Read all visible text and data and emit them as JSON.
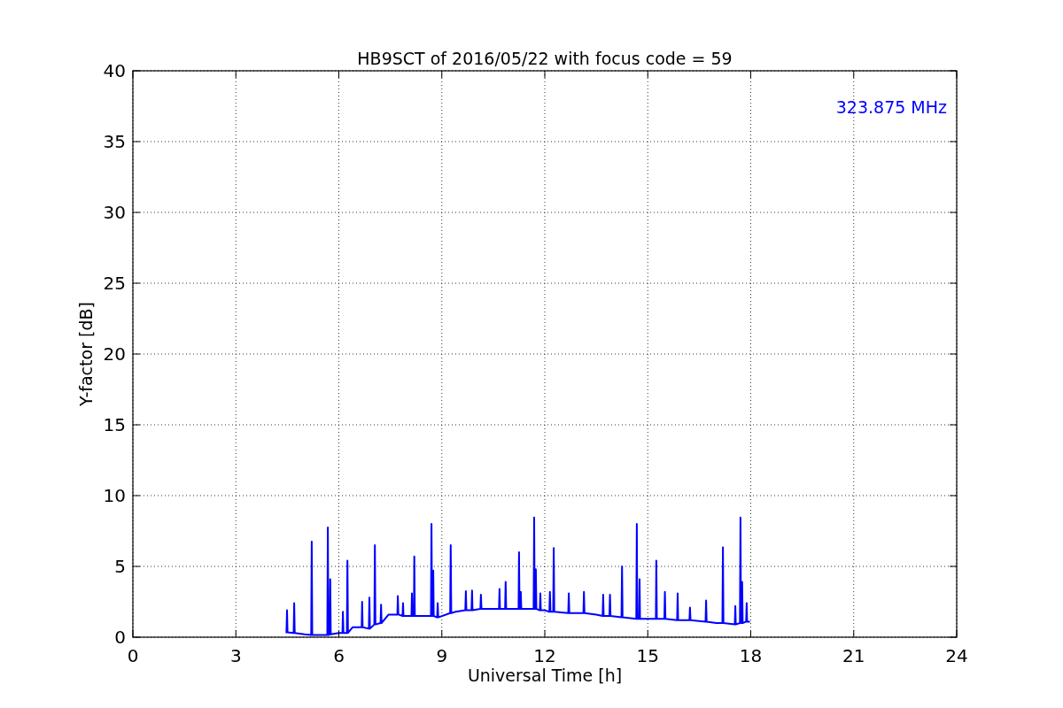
{
  "chart_data": {
    "type": "line",
    "title": "HB9SCT of 2016/05/22 with focus code = 59",
    "xlabel": "Universal Time [h]",
    "ylabel": "Y-factor [dB]",
    "xlim": [
      0,
      24
    ],
    "ylim": [
      0,
      40
    ],
    "grid": true,
    "xticks": [
      0,
      3,
      6,
      9,
      12,
      15,
      18,
      21,
      24
    ],
    "yticks": [
      0,
      5,
      10,
      15,
      20,
      25,
      30,
      35,
      40
    ],
    "x": [
      4.45,
      4.475,
      4.49,
      4.505,
      4.685,
      4.7,
      4.715,
      5.0,
      5.195,
      5.21,
      5.225,
      5.665,
      5.68,
      5.695,
      5.735,
      5.75,
      5.765,
      6.0,
      6.105,
      6.12,
      6.135,
      6.235,
      6.25,
      6.265,
      6.4,
      6.665,
      6.68,
      6.695,
      6.875,
      6.89,
      6.905,
      7.035,
      7.05,
      7.065,
      7.215,
      7.23,
      7.245,
      7.45,
      7.705,
      7.72,
      7.735,
      7.855,
      7.87,
      7.885,
      8.115,
      8.13,
      8.145,
      8.185,
      8.2,
      8.215,
      8.685,
      8.7,
      8.715,
      8.735,
      8.75,
      8.765,
      8.865,
      8.88,
      8.895,
      9.245,
      9.26,
      9.275,
      9.4,
      9.685,
      9.7,
      9.715,
      9.865,
      9.88,
      9.895,
      10.125,
      10.14,
      10.155,
      10.665,
      10.68,
      10.695,
      10.845,
      10.86,
      10.875,
      11.235,
      11.25,
      11.265,
      11.285,
      11.3,
      11.315,
      11.675,
      11.69,
      11.705,
      11.725,
      11.74,
      11.755,
      11.855,
      11.87,
      11.885,
      12.0,
      12.135,
      12.15,
      12.165,
      12.245,
      12.26,
      12.275,
      12.685,
      12.7,
      12.715,
      13.125,
      13.14,
      13.155,
      13.5,
      13.685,
      13.7,
      13.715,
      13.885,
      13.9,
      13.915,
      14.235,
      14.25,
      14.265,
      14.665,
      14.68,
      14.695,
      14.745,
      14.76,
      14.775,
      15.0,
      15.235,
      15.25,
      15.265,
      15.485,
      15.5,
      15.515,
      15.855,
      15.87,
      15.885,
      16.215,
      16.23,
      16.245,
      16.685,
      16.7,
      16.715,
      17.0,
      17.175,
      17.19,
      17.205,
      17.535,
      17.55,
      17.565,
      17.685,
      17.7,
      17.715,
      17.735,
      17.75,
      17.765,
      17.865,
      17.88,
      17.895,
      17.98
    ],
    "series": [
      {
        "name": "323.875 MHz",
        "color": "#0000ff",
        "values": [
          0.35,
          0.35,
          1.9,
          0.35,
          0.3,
          2.4,
          0.3,
          0.2,
          0.15,
          6.75,
          0.15,
          0.15,
          7.75,
          0.15,
          0.2,
          4.1,
          0.2,
          0.3,
          0.3,
          1.8,
          0.3,
          0.3,
          5.4,
          0.3,
          0.7,
          0.7,
          2.5,
          0.7,
          0.6,
          2.8,
          0.6,
          0.9,
          6.5,
          0.9,
          1.0,
          2.3,
          1.0,
          1.6,
          1.6,
          2.9,
          1.6,
          1.5,
          2.4,
          1.5,
          1.5,
          3.1,
          1.5,
          1.5,
          5.7,
          1.5,
          1.5,
          8.0,
          1.5,
          1.5,
          4.7,
          1.5,
          1.4,
          2.4,
          1.4,
          1.7,
          6.5,
          1.7,
          1.8,
          1.9,
          3.25,
          1.9,
          1.9,
          3.3,
          1.9,
          2.0,
          3.0,
          2.0,
          2.0,
          3.4,
          2.0,
          2.0,
          3.9,
          2.0,
          2.0,
          6.0,
          2.0,
          2.0,
          3.2,
          2.0,
          2.0,
          8.45,
          2.0,
          2.0,
          4.8,
          2.0,
          1.9,
          3.1,
          1.9,
          1.9,
          1.8,
          3.2,
          1.8,
          1.8,
          6.3,
          1.8,
          1.7,
          3.1,
          1.7,
          1.7,
          3.2,
          1.7,
          1.6,
          1.5,
          3.0,
          1.5,
          1.5,
          3.0,
          1.5,
          1.4,
          5.0,
          1.4,
          1.3,
          8.0,
          1.3,
          1.3,
          4.1,
          1.3,
          1.3,
          1.3,
          5.4,
          1.3,
          1.3,
          3.2,
          1.3,
          1.2,
          3.1,
          1.2,
          1.2,
          2.1,
          1.2,
          1.1,
          2.6,
          1.1,
          1.0,
          1.0,
          6.35,
          1.0,
          0.9,
          2.2,
          0.9,
          1.0,
          8.45,
          1.0,
          1.0,
          3.9,
          1.0,
          1.1,
          2.4,
          1.1,
          1.1
        ]
      }
    ]
  }
}
